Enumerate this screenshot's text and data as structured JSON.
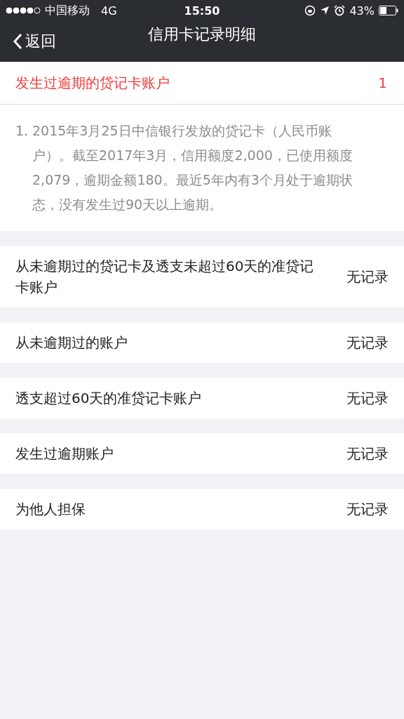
{
  "status_bar": {
    "carrier": "中国移动",
    "network": "4G",
    "time": "15:50",
    "battery": "43%"
  },
  "nav": {
    "back": "返回",
    "title": "信用卡记录明细"
  },
  "overdue_section": {
    "title": "发生过逾期的贷记卡账户",
    "count": "1",
    "items": [
      {
        "number": "1.",
        "text": "2015年3月25日中信银行发放的贷记卡（人民币账户）。截至2017年3月，信用额度2,000，已使用额度2,079，逾期金额180。最近5年内有3个月处于逾期状态，没有发生过90天以上逾期。"
      }
    ]
  },
  "records": [
    {
      "label": "从未逾期过的贷记卡及透支未超过60天的准贷记卡账户",
      "value": "无记录"
    },
    {
      "label": "从未逾期过的账户",
      "value": "无记录"
    },
    {
      "label": "透支超过60天的准贷记卡账户",
      "value": "无记录"
    },
    {
      "label": "发生过逾期账户",
      "value": "无记录"
    },
    {
      "label": "为他人担保",
      "value": "无记录"
    }
  ]
}
